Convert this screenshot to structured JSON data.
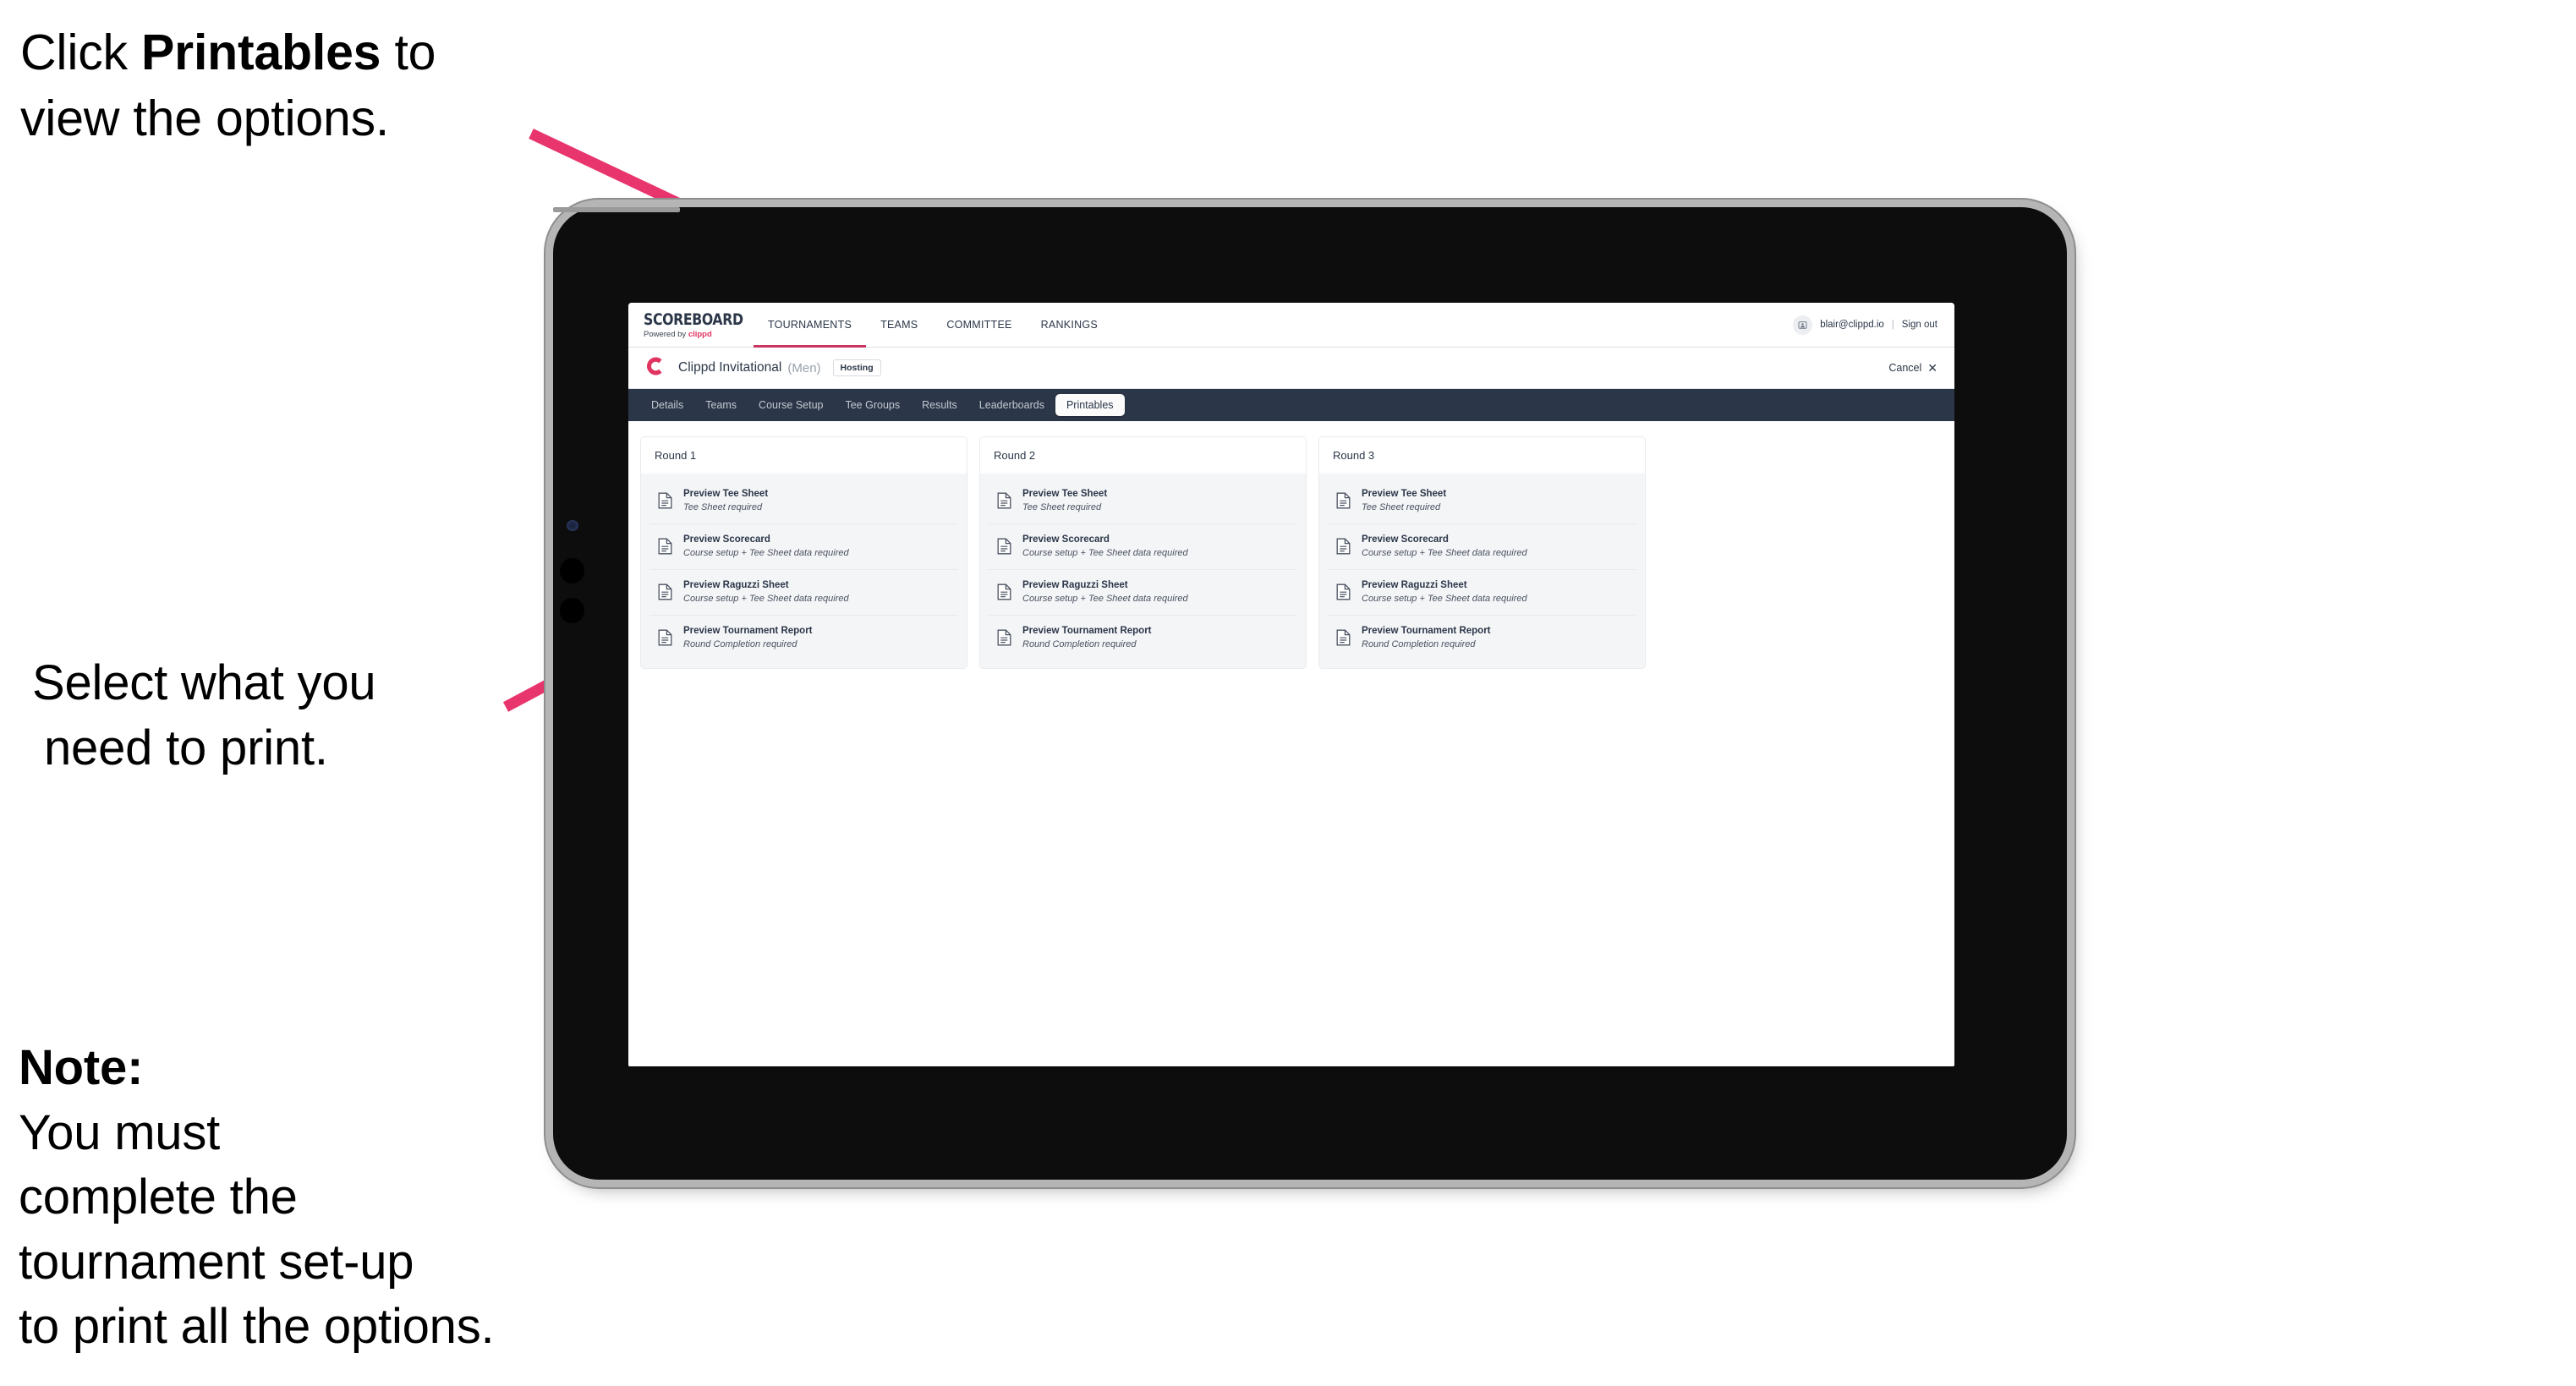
{
  "annotations": {
    "callout_top": {
      "line1_pre": "Click ",
      "line1_bold": "Printables",
      "line1_post": " to",
      "line2": "view the options."
    },
    "callout_middle": {
      "line1": "Select what you",
      "line2": "need to print."
    },
    "callout_note": {
      "bold": "Note:",
      "line1_rest": " You must",
      "line2": "complete the",
      "line3": "tournament set-up",
      "line4": "to print all the options."
    },
    "arrow_color": "#e8356d"
  },
  "app": {
    "brand": {
      "title": "SCOREBOARD",
      "powered_by_prefix": "Powered by ",
      "powered_by_name": "clippd",
      "accent_color": "#e0335f"
    },
    "topnav": {
      "items": [
        {
          "label": "TOURNAMENTS",
          "active": true
        },
        {
          "label": "TEAMS",
          "active": false
        },
        {
          "label": "COMMITTEE",
          "active": false
        },
        {
          "label": "RANKINGS",
          "active": false
        }
      ],
      "active_underline_color": "#c8365f"
    },
    "user": {
      "avatar_icon": "user-avatar-icon",
      "email": "blair@clippd.io",
      "separator": "|",
      "sign_out_label": "Sign out"
    },
    "tournament_header": {
      "logo_letter": "C",
      "name": "Clippd Invitational",
      "gender": "(Men)",
      "status_badge": "Hosting",
      "cancel_label": "Cancel",
      "cancel_icon": "close-icon"
    },
    "tabs": {
      "bar_color": "#2b3648",
      "items": [
        {
          "label": "Details",
          "active": false
        },
        {
          "label": "Teams",
          "active": false
        },
        {
          "label": "Course Setup",
          "active": false
        },
        {
          "label": "Tee Groups",
          "active": false
        },
        {
          "label": "Results",
          "active": false
        },
        {
          "label": "Leaderboards",
          "active": false
        },
        {
          "label": "Printables",
          "active": true
        }
      ]
    },
    "rounds": [
      {
        "title": "Round 1",
        "printables": [
          {
            "title": "Preview Tee Sheet",
            "requirement": "Tee Sheet required",
            "icon": "document-icon"
          },
          {
            "title": "Preview Scorecard",
            "requirement": "Course setup + Tee Sheet data required",
            "icon": "document-icon"
          },
          {
            "title": "Preview Raguzzi Sheet",
            "requirement": "Course setup + Tee Sheet data required",
            "icon": "document-icon"
          },
          {
            "title": "Preview Tournament Report",
            "requirement": "Round Completion required",
            "icon": "document-icon"
          }
        ]
      },
      {
        "title": "Round 2",
        "printables": [
          {
            "title": "Preview Tee Sheet",
            "requirement": "Tee Sheet required",
            "icon": "document-icon"
          },
          {
            "title": "Preview Scorecard",
            "requirement": "Course setup + Tee Sheet data required",
            "icon": "document-icon"
          },
          {
            "title": "Preview Raguzzi Sheet",
            "requirement": "Course setup + Tee Sheet data required",
            "icon": "document-icon"
          },
          {
            "title": "Preview Tournament Report",
            "requirement": "Round Completion required",
            "icon": "document-icon"
          }
        ]
      },
      {
        "title": "Round 3",
        "printables": [
          {
            "title": "Preview Tee Sheet",
            "requirement": "Tee Sheet required",
            "icon": "document-icon"
          },
          {
            "title": "Preview Scorecard",
            "requirement": "Course setup + Tee Sheet data required",
            "icon": "document-icon"
          },
          {
            "title": "Preview Raguzzi Sheet",
            "requirement": "Course setup + Tee Sheet data required",
            "icon": "document-icon"
          },
          {
            "title": "Preview Tournament Report",
            "requirement": "Round Completion required",
            "icon": "document-icon"
          }
        ]
      }
    ]
  }
}
